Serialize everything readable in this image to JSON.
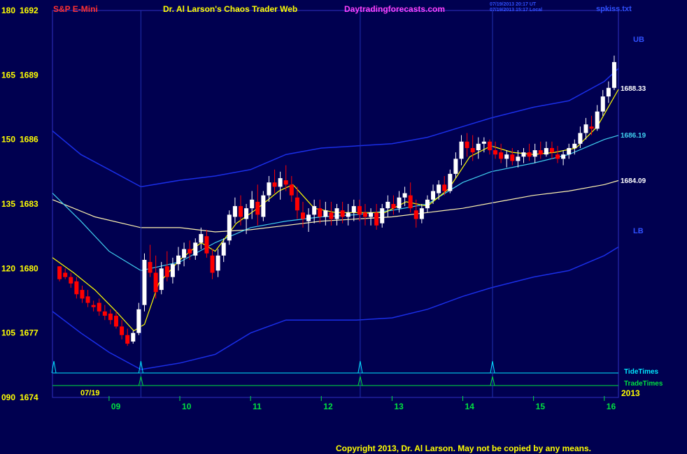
{
  "header": {
    "symbol": "S&P E-Mini",
    "title": "Dr. Al Larson's Chaos Trader Web",
    "site": "Daytradingforecasts.com",
    "stamp1": "07/19/2013 20:17 UT",
    "stamp2": "07/19/2013 15:17 Local",
    "file": "spkiss.txt"
  },
  "footer": {
    "copyright": "Copyright 2013, Dr. Al Larson. May not be copied by any means."
  },
  "colors": {
    "background": "#000050",
    "up_bar": "#ffffff",
    "down_bar": "#ff0000",
    "band": "#1a2ee8",
    "mid_line": "#fff4b0",
    "cyan_line": "#40d0f0",
    "fast_line": "#ffff00",
    "tide": "#00e8ff",
    "trade": "#00e040",
    "red_text": "#ff3030",
    "yellow_text": "#ffff00",
    "magenta_text": "#ff40ff",
    "green_text": "#00e040",
    "blue_text": "#3050ff"
  },
  "chart_data": {
    "type": "candlestick",
    "symbol": "S&P E-Mini",
    "date_label": "07/19",
    "year_label": "2013",
    "y_labels": [
      {
        "left": "180",
        "price": "1692"
      },
      {
        "left": "165",
        "price": "1689"
      },
      {
        "left": "150",
        "price": "1686"
      },
      {
        "left": "135",
        "price": "1683"
      },
      {
        "left": "120",
        "price": "1680"
      },
      {
        "left": "105",
        "price": "1677"
      },
      {
        "left": "090",
        "price": "1674"
      }
    ],
    "y_range": [
      1674,
      1692
    ],
    "x_ticks": [
      "09",
      "10",
      "11",
      "12",
      "13",
      "14",
      "15",
      "16"
    ],
    "x_range": [
      8.2,
      16.2
    ],
    "band_labels": {
      "upper": "UB",
      "lower": "LB"
    },
    "line_values": [
      {
        "label": "1688.33",
        "color": "#ffffff"
      },
      {
        "label": "1686.19",
        "color": "#40d0f0"
      },
      {
        "label": "1684.09",
        "color": "#ffffff"
      }
    ],
    "markers": {
      "tide_label": "TideTimes",
      "trade_label": "TradeTimes",
      "times": [
        9.45,
        12.55,
        14.42
      ]
    },
    "bars": [
      [
        8.3,
        1680.1,
        1680.1,
        1679.4,
        1679.5
      ],
      [
        8.38,
        1679.8,
        1680.0,
        1679.5,
        1679.6
      ],
      [
        8.46,
        1679.6,
        1679.8,
        1679.1,
        1679.3
      ],
      [
        8.54,
        1679.4,
        1679.6,
        1678.6,
        1678.8
      ],
      [
        8.62,
        1679.0,
        1679.2,
        1678.4,
        1678.6
      ],
      [
        8.7,
        1678.7,
        1679.0,
        1678.2,
        1678.4
      ],
      [
        8.78,
        1678.3,
        1678.5,
        1678.0,
        1678.2
      ],
      [
        8.86,
        1678.4,
        1678.6,
        1677.8,
        1678.0
      ],
      [
        8.94,
        1678.0,
        1678.3,
        1677.6,
        1677.8
      ],
      [
        9.02,
        1677.9,
        1678.1,
        1677.4,
        1677.6
      ],
      [
        9.1,
        1677.8,
        1678.0,
        1677.2,
        1677.3
      ],
      [
        9.18,
        1677.3,
        1677.6,
        1676.7,
        1676.9
      ],
      [
        9.26,
        1676.9,
        1677.2,
        1676.4,
        1676.5
      ],
      [
        9.34,
        1676.6,
        1677.1,
        1676.5,
        1677.0
      ],
      [
        9.42,
        1677.0,
        1678.4,
        1676.9,
        1678.1
      ],
      [
        9.5,
        1678.3,
        1680.7,
        1678.0,
        1680.4
      ],
      [
        9.58,
        1680.3,
        1681.1,
        1679.6,
        1679.8
      ],
      [
        9.66,
        1679.8,
        1680.6,
        1678.6,
        1678.9
      ],
      [
        9.74,
        1679.0,
        1680.3,
        1678.8,
        1680.0
      ],
      [
        9.82,
        1680.1,
        1680.8,
        1679.4,
        1679.6
      ],
      [
        9.9,
        1679.6,
        1680.5,
        1679.3,
        1680.2
      ],
      [
        9.98,
        1680.2,
        1681.0,
        1679.9,
        1680.6
      ],
      [
        10.06,
        1680.5,
        1681.2,
        1680.1,
        1680.9
      ],
      [
        10.14,
        1680.9,
        1681.3,
        1680.4,
        1680.7
      ],
      [
        10.22,
        1680.6,
        1681.4,
        1680.4,
        1681.2
      ],
      [
        10.3,
        1681.2,
        1681.9,
        1680.9,
        1681.6
      ],
      [
        10.38,
        1681.5,
        1681.8,
        1680.5,
        1680.7
      ],
      [
        10.46,
        1680.6,
        1680.9,
        1679.5,
        1679.8
      ],
      [
        10.54,
        1679.9,
        1680.9,
        1679.6,
        1680.6
      ],
      [
        10.62,
        1680.6,
        1681.4,
        1680.3,
        1681.2
      ],
      [
        10.7,
        1681.3,
        1682.7,
        1681.1,
        1682.5
      ],
      [
        10.78,
        1682.4,
        1683.3,
        1682.1,
        1682.9
      ],
      [
        10.86,
        1682.9,
        1683.4,
        1682.0,
        1682.4
      ],
      [
        10.94,
        1682.3,
        1683.0,
        1681.6,
        1682.8
      ],
      [
        11.02,
        1682.8,
        1683.6,
        1682.3,
        1683.2
      ],
      [
        11.1,
        1683.1,
        1683.9,
        1682.0,
        1682.5
      ],
      [
        11.18,
        1682.4,
        1683.6,
        1682.2,
        1683.4
      ],
      [
        11.26,
        1683.4,
        1684.3,
        1683.1,
        1684.0
      ],
      [
        11.34,
        1684.0,
        1684.6,
        1683.5,
        1683.8
      ],
      [
        11.42,
        1683.8,
        1684.5,
        1683.2,
        1684.2
      ],
      [
        11.5,
        1684.1,
        1684.8,
        1683.6,
        1683.9
      ],
      [
        11.58,
        1683.9,
        1684.3,
        1683.1,
        1683.4
      ],
      [
        11.66,
        1683.3,
        1683.8,
        1682.3,
        1682.7
      ],
      [
        11.74,
        1682.6,
        1683.1,
        1681.9,
        1682.3
      ],
      [
        11.82,
        1682.2,
        1682.8,
        1681.7,
        1682.5
      ],
      [
        11.9,
        1682.5,
        1683.2,
        1682.1,
        1682.9
      ],
      [
        11.98,
        1682.8,
        1683.2,
        1682.1,
        1682.4
      ],
      [
        12.06,
        1682.4,
        1683.1,
        1682.0,
        1682.7
      ],
      [
        12.14,
        1682.6,
        1683.1,
        1682.0,
        1682.3
      ],
      [
        12.22,
        1682.3,
        1683.0,
        1682.0,
        1682.8
      ],
      [
        12.3,
        1682.7,
        1683.1,
        1682.1,
        1682.4
      ],
      [
        12.38,
        1682.4,
        1683.0,
        1682.0,
        1682.6
      ],
      [
        12.46,
        1682.6,
        1683.2,
        1682.2,
        1682.9
      ],
      [
        12.54,
        1682.9,
        1683.2,
        1682.2,
        1682.5
      ],
      [
        12.62,
        1682.6,
        1683.0,
        1682.0,
        1682.4
      ],
      [
        12.7,
        1682.4,
        1682.8,
        1682.0,
        1682.6
      ],
      [
        12.78,
        1682.6,
        1683.0,
        1681.8,
        1682.0
      ],
      [
        12.86,
        1682.1,
        1683.0,
        1681.9,
        1682.8
      ],
      [
        12.94,
        1682.8,
        1683.4,
        1682.4,
        1683.1
      ],
      [
        13.02,
        1683.0,
        1683.4,
        1682.5,
        1682.8
      ],
      [
        13.1,
        1682.8,
        1683.6,
        1682.6,
        1683.3
      ],
      [
        13.18,
        1683.3,
        1683.8,
        1682.9,
        1683.5
      ],
      [
        13.26,
        1683.4,
        1684.0,
        1682.6,
        1682.8
      ],
      [
        13.34,
        1682.7,
        1683.2,
        1681.9,
        1682.3
      ],
      [
        13.42,
        1682.3,
        1683.0,
        1682.1,
        1682.8
      ],
      [
        13.5,
        1682.8,
        1683.4,
        1682.6,
        1683.2
      ],
      [
        13.58,
        1683.2,
        1683.9,
        1683.0,
        1683.6
      ],
      [
        13.66,
        1683.5,
        1684.1,
        1683.2,
        1683.9
      ],
      [
        13.74,
        1683.9,
        1684.3,
        1683.4,
        1683.6
      ],
      [
        13.82,
        1683.6,
        1684.6,
        1683.5,
        1684.4
      ],
      [
        13.9,
        1684.4,
        1685.4,
        1684.2,
        1685.1
      ],
      [
        13.98,
        1685.1,
        1686.2,
        1684.8,
        1685.9
      ],
      [
        14.06,
        1685.9,
        1686.3,
        1685.2,
        1685.6
      ],
      [
        14.14,
        1685.6,
        1686.2,
        1685.0,
        1685.4
      ],
      [
        14.22,
        1685.5,
        1686.1,
        1685.1,
        1685.8
      ],
      [
        14.3,
        1685.8,
        1686.1,
        1685.4,
        1685.9
      ],
      [
        14.38,
        1685.9,
        1686.0,
        1685.3,
        1685.5
      ],
      [
        14.46,
        1685.5,
        1685.9,
        1685.1,
        1685.3
      ],
      [
        14.54,
        1685.4,
        1685.8,
        1684.9,
        1685.1
      ],
      [
        14.62,
        1685.1,
        1685.5,
        1684.7,
        1685.3
      ],
      [
        14.7,
        1685.3,
        1685.6,
        1684.8,
        1685.0
      ],
      [
        14.78,
        1685.0,
        1685.5,
        1684.7,
        1685.2
      ],
      [
        14.86,
        1685.2,
        1685.6,
        1684.9,
        1685.4
      ],
      [
        14.94,
        1685.4,
        1685.8,
        1685.0,
        1685.2
      ],
      [
        15.02,
        1685.2,
        1685.8,
        1684.9,
        1685.5
      ],
      [
        15.1,
        1685.5,
        1685.9,
        1685.1,
        1685.3
      ],
      [
        15.18,
        1685.3,
        1685.9,
        1685.2,
        1685.6
      ],
      [
        15.26,
        1685.6,
        1685.9,
        1685.1,
        1685.4
      ],
      [
        15.34,
        1685.3,
        1685.7,
        1684.9,
        1685.1
      ],
      [
        15.42,
        1685.1,
        1685.5,
        1684.8,
        1685.3
      ],
      [
        15.5,
        1685.3,
        1685.8,
        1685.1,
        1685.6
      ],
      [
        15.58,
        1685.6,
        1686.0,
        1685.3,
        1685.8
      ],
      [
        15.66,
        1685.8,
        1686.6,
        1685.6,
        1686.3
      ],
      [
        15.74,
        1686.3,
        1687.0,
        1686.0,
        1686.7
      ],
      [
        15.82,
        1686.6,
        1687.1,
        1686.2,
        1686.5
      ],
      [
        15.9,
        1686.5,
        1687.6,
        1686.4,
        1687.3
      ],
      [
        15.98,
        1687.3,
        1688.3,
        1687.1,
        1688.0
      ],
      [
        16.06,
        1688.0,
        1688.7,
        1687.7,
        1688.4
      ],
      [
        16.14,
        1688.4,
        1689.9,
        1688.3,
        1689.6
      ]
    ],
    "series": [
      {
        "name": "UB",
        "color": "#1a2ee8",
        "points": [
          [
            8.2,
            1686.4
          ],
          [
            8.6,
            1685.3
          ],
          [
            9.0,
            1684.6
          ],
          [
            9.45,
            1683.8
          ],
          [
            10.0,
            1684.1
          ],
          [
            10.5,
            1684.3
          ],
          [
            11.0,
            1684.6
          ],
          [
            11.5,
            1685.3
          ],
          [
            12.0,
            1685.6
          ],
          [
            12.5,
            1685.7
          ],
          [
            13.0,
            1685.8
          ],
          [
            13.5,
            1686.1
          ],
          [
            14.0,
            1686.6
          ],
          [
            14.4,
            1687.0
          ],
          [
            15.0,
            1687.5
          ],
          [
            15.5,
            1687.8
          ],
          [
            16.0,
            1688.7
          ],
          [
            16.2,
            1689.3
          ]
        ]
      },
      {
        "name": "LB",
        "color": "#1a2ee8",
        "points": [
          [
            8.2,
            1678.0
          ],
          [
            8.6,
            1677.0
          ],
          [
            9.0,
            1676.1
          ],
          [
            9.45,
            1675.3
          ],
          [
            10.0,
            1675.6
          ],
          [
            10.5,
            1676.0
          ],
          [
            11.0,
            1677.0
          ],
          [
            11.5,
            1677.6
          ],
          [
            12.0,
            1677.6
          ],
          [
            12.5,
            1677.6
          ],
          [
            13.0,
            1677.7
          ],
          [
            13.5,
            1678.1
          ],
          [
            14.0,
            1678.7
          ],
          [
            14.4,
            1679.1
          ],
          [
            15.0,
            1679.6
          ],
          [
            15.5,
            1679.9
          ],
          [
            16.0,
            1680.6
          ],
          [
            16.2,
            1681.0
          ]
        ]
      },
      {
        "name": "",
        "color": "#fff4b0",
        "points": [
          [
            8.2,
            1683.2
          ],
          [
            8.8,
            1682.4
          ],
          [
            9.45,
            1681.9
          ],
          [
            10.0,
            1681.9
          ],
          [
            10.5,
            1681.7
          ],
          [
            11.0,
            1681.8
          ],
          [
            11.5,
            1682.0
          ],
          [
            12.0,
            1682.2
          ],
          [
            12.5,
            1682.3
          ],
          [
            13.0,
            1682.4
          ],
          [
            13.5,
            1682.6
          ],
          [
            14.0,
            1682.8
          ],
          [
            14.5,
            1683.1
          ],
          [
            15.0,
            1683.4
          ],
          [
            15.5,
            1683.6
          ],
          [
            16.0,
            1683.9
          ],
          [
            16.2,
            1684.09
          ]
        ]
      },
      {
        "name": "",
        "color": "#40d0f0",
        "points": [
          [
            8.2,
            1683.5
          ],
          [
            8.6,
            1682.2
          ],
          [
            9.0,
            1680.8
          ],
          [
            9.45,
            1679.9
          ],
          [
            10.0,
            1680.3
          ],
          [
            10.5,
            1681.2
          ],
          [
            11.0,
            1681.9
          ],
          [
            11.5,
            1682.2
          ],
          [
            12.0,
            1682.4
          ],
          [
            12.5,
            1682.5
          ],
          [
            13.0,
            1682.7
          ],
          [
            13.5,
            1683.0
          ],
          [
            14.0,
            1684.0
          ],
          [
            14.4,
            1684.5
          ],
          [
            15.0,
            1684.9
          ],
          [
            15.5,
            1685.3
          ],
          [
            16.0,
            1686.0
          ],
          [
            16.2,
            1686.19
          ]
        ]
      },
      {
        "name": "",
        "color": "#ffff00",
        "points": [
          [
            8.2,
            1680.5
          ],
          [
            8.5,
            1679.8
          ],
          [
            8.8,
            1679.0
          ],
          [
            9.1,
            1678.0
          ],
          [
            9.35,
            1677.1
          ],
          [
            9.5,
            1677.4
          ],
          [
            9.7,
            1679.3
          ],
          [
            10.0,
            1680.4
          ],
          [
            10.3,
            1681.2
          ],
          [
            10.5,
            1680.8
          ],
          [
            10.8,
            1682.1
          ],
          [
            11.1,
            1682.8
          ],
          [
            11.4,
            1683.6
          ],
          [
            11.6,
            1683.9
          ],
          [
            11.9,
            1682.8
          ],
          [
            12.2,
            1682.6
          ],
          [
            12.6,
            1682.6
          ],
          [
            12.9,
            1682.6
          ],
          [
            13.2,
            1683.1
          ],
          [
            13.5,
            1682.9
          ],
          [
            13.8,
            1683.7
          ],
          [
            14.1,
            1685.2
          ],
          [
            14.4,
            1685.7
          ],
          [
            14.7,
            1685.4
          ],
          [
            15.0,
            1685.3
          ],
          [
            15.3,
            1685.4
          ],
          [
            15.6,
            1685.6
          ],
          [
            15.9,
            1686.6
          ],
          [
            16.2,
            1688.33
          ]
        ]
      }
    ]
  }
}
